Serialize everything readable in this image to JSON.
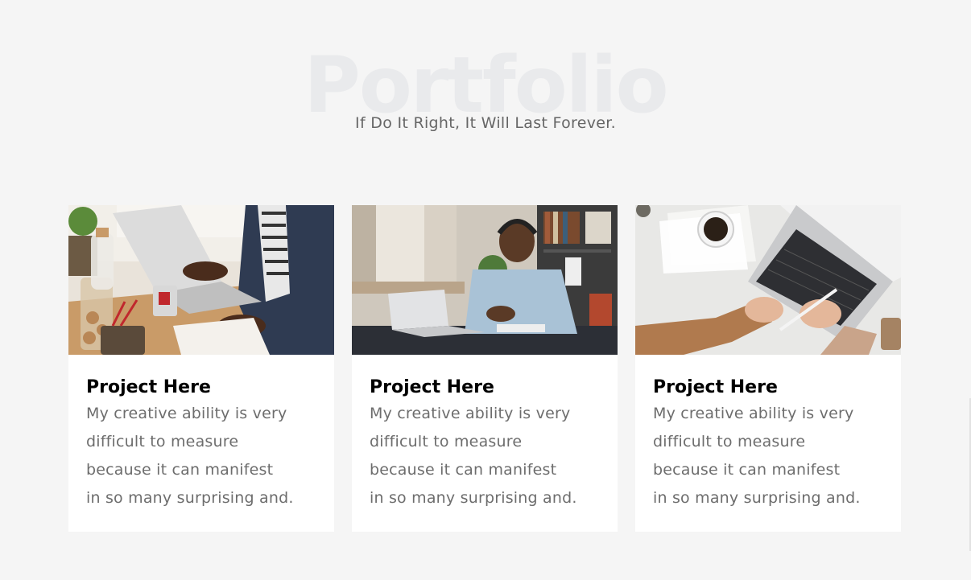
{
  "portfolio": {
    "bg_title": "Portfolio",
    "subtitle": "If Do It Right, It Will Last Forever.",
    "cards": [
      {
        "title": "Project Here",
        "text_lines": [
          "My creative ability is very",
          "difficult to measure",
          "because it can manifest",
          "in so many surprising and."
        ],
        "image": "workspace-laptop-photo"
      },
      {
        "title": "Project Here",
        "text_lines": [
          "My creative ability is very",
          "difficult to measure",
          "because it can manifest",
          "in so many surprising and."
        ],
        "image": "man-with-headphones-photo"
      },
      {
        "title": "Project Here",
        "text_lines": [
          "My creative ability is very",
          "difficult to measure",
          "because it can manifest",
          "in so many surprising and."
        ],
        "image": "laptop-topdown-photo"
      }
    ]
  },
  "colors": {
    "background": "#f5f5f5",
    "card": "#ffffff",
    "title": "#000000",
    "text": "#6d6d6d",
    "watermark": "#e9eaec"
  }
}
